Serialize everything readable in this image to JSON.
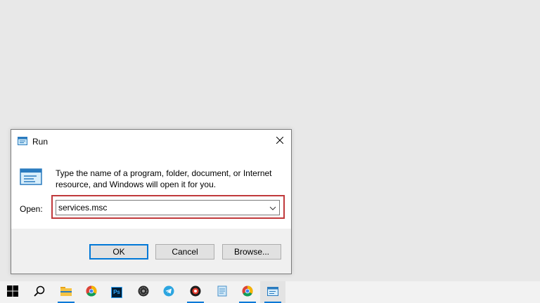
{
  "dialog": {
    "title": "Run",
    "description": "Type the name of a program, folder, document, or Internet resource, and Windows will open it for you.",
    "open_label": "Open:",
    "open_value": "services.msc",
    "ok_label": "OK",
    "cancel_label": "Cancel",
    "browse_label": "Browse..."
  },
  "taskbar": {
    "items": [
      {
        "icon": "windows-start-icon"
      },
      {
        "icon": "search-icon"
      },
      {
        "icon": "file-explorer-icon"
      },
      {
        "icon": "chrome-icon"
      },
      {
        "icon": "photoshop-icon",
        "text": "Ps"
      },
      {
        "icon": "app-dark-circle-icon"
      },
      {
        "icon": "telegram-icon"
      },
      {
        "icon": "app-red-circle-icon"
      },
      {
        "icon": "notepad-icon"
      },
      {
        "icon": "chrome-icon"
      },
      {
        "icon": "run-icon"
      }
    ]
  },
  "colors": {
    "highlight": "#c0393b",
    "accent": "#0078d7",
    "desktop": "#e8e8e8",
    "taskbar": "#f2f2f2"
  }
}
